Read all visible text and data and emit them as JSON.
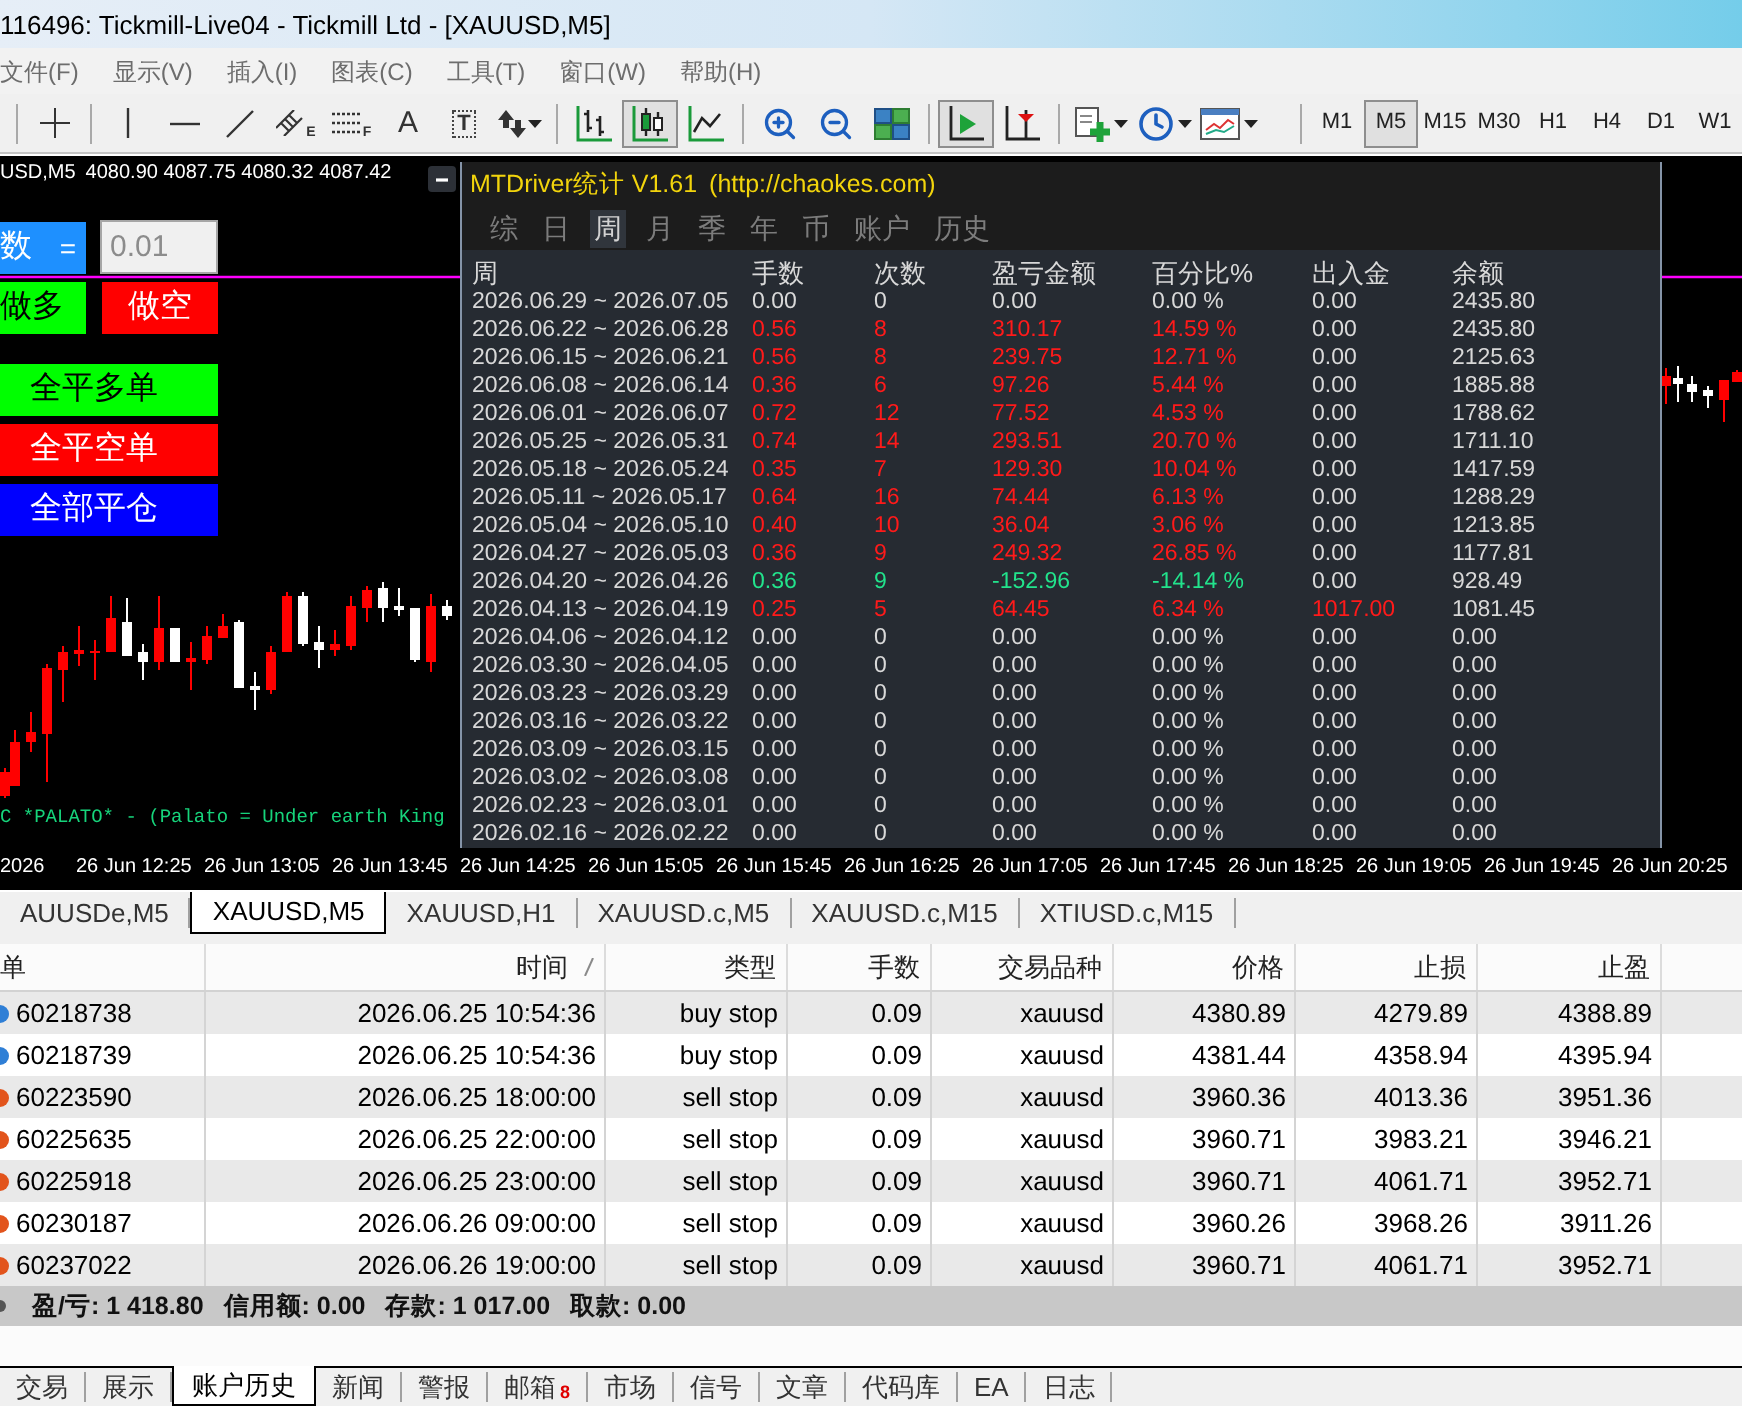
{
  "window": {
    "title": "116496: Tickmill-Live04 - Tickmill Ltd - [XAUUSD,M5]"
  },
  "menu": [
    "文件(F)",
    "显示(V)",
    "插入(I)",
    "图表(C)",
    "工具(T)",
    "窗口(W)",
    "帮助(H)"
  ],
  "toolbar": {
    "drawing_tools": [
      {
        "kind": "crosshair"
      },
      {
        "kind": "vline"
      },
      {
        "kind": "hline"
      },
      {
        "kind": "trendline"
      },
      {
        "kind": "channel",
        "mark": "E"
      },
      {
        "kind": "fibo",
        "mark": "F"
      },
      {
        "kind": "text",
        "mark": "A"
      },
      {
        "kind": "label",
        "mark": "T"
      },
      {
        "kind": "arrows"
      }
    ],
    "chart_types": [
      {
        "kind": "bars",
        "selected": false
      },
      {
        "kind": "candles",
        "selected": true
      },
      {
        "kind": "line",
        "selected": false
      }
    ],
    "auto_scroll": {
      "on": true
    },
    "chart_shift": {
      "on": false
    },
    "timeframes": [
      {
        "label": "M1",
        "selected": false
      },
      {
        "label": "M5",
        "selected": true
      },
      {
        "label": "M15",
        "selected": false
      },
      {
        "label": "M30",
        "selected": false
      },
      {
        "label": "H1",
        "selected": false
      },
      {
        "label": "H4",
        "selected": false
      },
      {
        "label": "D1",
        "selected": false
      },
      {
        "label": "W1",
        "selected": false
      }
    ]
  },
  "chart": {
    "symbol": "USD,M5",
    "ohlc": "4080.90 4087.75 4080.32 4087.42",
    "lot_label": "数",
    "lot_sign": "=",
    "lot_input": {
      "value": "0.01"
    },
    "order_buttons": [
      {
        "label": "做多",
        "kind": "long"
      },
      {
        "label": "做空",
        "kind": "short"
      }
    ],
    "close_buttons": [
      {
        "label": "全平多单",
        "kind": "long"
      },
      {
        "label": "全平空单",
        "kind": "short"
      },
      {
        "label": "全部平仓",
        "kind": "all"
      }
    ],
    "comment": "C *PALATO* - (Palato = Under earth King",
    "time_axis": [
      "2026",
      "26 Jun 12:25",
      "26 Jun 13:05",
      "26 Jun 13:45",
      "26 Jun 14:25",
      "26 Jun 15:05",
      "26 Jun 15:45",
      "26 Jun 16:25",
      "26 Jun 17:05",
      "26 Jun 17:45",
      "26 Jun 18:25",
      "26 Jun 19:05",
      "26 Jun 19:45",
      "26 Jun 20:25"
    ]
  },
  "stats_panel": {
    "title": "MTDriver统计 V1.61",
    "url": "(http://chaokes.com)",
    "tabs": [
      {
        "label": "综",
        "selected": false
      },
      {
        "label": "日",
        "selected": false
      },
      {
        "label": "周",
        "selected": true
      },
      {
        "label": "月",
        "selected": false
      },
      {
        "label": "季",
        "selected": false
      },
      {
        "label": "年",
        "selected": false
      },
      {
        "label": "币",
        "selected": false
      },
      {
        "label": "账户",
        "selected": false
      },
      {
        "label": "历史",
        "selected": false
      }
    ],
    "columns": [
      "周",
      "手数",
      "次数",
      "盈亏金额",
      "百分比%",
      "出入金",
      "余额"
    ],
    "rows": [
      {
        "cells": [
          "2026.06.29 ~ 2026.07.05",
          "0.00",
          "0",
          "0.00",
          "0.00 %",
          "0.00",
          "2435.80"
        ],
        "kind": "flat",
        "deposit_marked": false
      },
      {
        "cells": [
          "2026.06.22 ~ 2026.06.28",
          "0.56",
          "8",
          "310.17",
          "14.59 %",
          "0.00",
          "2435.80"
        ],
        "kind": "gain",
        "deposit_marked": false
      },
      {
        "cells": [
          "2026.06.15 ~ 2026.06.21",
          "0.56",
          "8",
          "239.75",
          "12.71 %",
          "0.00",
          "2125.63"
        ],
        "kind": "gain",
        "deposit_marked": false
      },
      {
        "cells": [
          "2026.06.08 ~ 2026.06.14",
          "0.36",
          "6",
          "97.26",
          "5.44 %",
          "0.00",
          "1885.88"
        ],
        "kind": "gain",
        "deposit_marked": false
      },
      {
        "cells": [
          "2026.06.01 ~ 2026.06.07",
          "0.72",
          "12",
          "77.52",
          "4.53 %",
          "0.00",
          "1788.62"
        ],
        "kind": "gain",
        "deposit_marked": false
      },
      {
        "cells": [
          "2026.05.25 ~ 2026.05.31",
          "0.74",
          "14",
          "293.51",
          "20.70 %",
          "0.00",
          "1711.10"
        ],
        "kind": "gain",
        "deposit_marked": false
      },
      {
        "cells": [
          "2026.05.18 ~ 2026.05.24",
          "0.35",
          "7",
          "129.30",
          "10.04 %",
          "0.00",
          "1417.59"
        ],
        "kind": "gain",
        "deposit_marked": false
      },
      {
        "cells": [
          "2026.05.11 ~ 2026.05.17",
          "0.64",
          "16",
          "74.44",
          "6.13 %",
          "0.00",
          "1288.29"
        ],
        "kind": "gain",
        "deposit_marked": false
      },
      {
        "cells": [
          "2026.05.04 ~ 2026.05.10",
          "0.40",
          "10",
          "36.04",
          "3.06 %",
          "0.00",
          "1213.85"
        ],
        "kind": "gain",
        "deposit_marked": false
      },
      {
        "cells": [
          "2026.04.27 ~ 2026.05.03",
          "0.36",
          "9",
          "249.32",
          "26.85 %",
          "0.00",
          "1177.81"
        ],
        "kind": "gain",
        "deposit_marked": false
      },
      {
        "cells": [
          "2026.04.20 ~ 2026.04.26",
          "0.36",
          "9",
          "-152.96",
          "-14.14 %",
          "0.00",
          "928.49"
        ],
        "kind": "loss",
        "deposit_marked": false
      },
      {
        "cells": [
          "2026.04.13 ~ 2026.04.19",
          "0.25",
          "5",
          "64.45",
          "6.34 %",
          "1017.00",
          "1081.45"
        ],
        "kind": "gain",
        "deposit_marked": true
      },
      {
        "cells": [
          "2026.04.06 ~ 2026.04.12",
          "0.00",
          "0",
          "0.00",
          "0.00 %",
          "0.00",
          "0.00"
        ],
        "kind": "flat",
        "deposit_marked": false
      },
      {
        "cells": [
          "2026.03.30 ~ 2026.04.05",
          "0.00",
          "0",
          "0.00",
          "0.00 %",
          "0.00",
          "0.00"
        ],
        "kind": "flat",
        "deposit_marked": false
      },
      {
        "cells": [
          "2026.03.23 ~ 2026.03.29",
          "0.00",
          "0",
          "0.00",
          "0.00 %",
          "0.00",
          "0.00"
        ],
        "kind": "flat",
        "deposit_marked": false
      },
      {
        "cells": [
          "2026.03.16 ~ 2026.03.22",
          "0.00",
          "0",
          "0.00",
          "0.00 %",
          "0.00",
          "0.00"
        ],
        "kind": "flat",
        "deposit_marked": false
      },
      {
        "cells": [
          "2026.03.09 ~ 2026.03.15",
          "0.00",
          "0",
          "0.00",
          "0.00 %",
          "0.00",
          "0.00"
        ],
        "kind": "flat",
        "deposit_marked": false
      },
      {
        "cells": [
          "2026.03.02 ~ 2026.03.08",
          "0.00",
          "0",
          "0.00",
          "0.00 %",
          "0.00",
          "0.00"
        ],
        "kind": "flat",
        "deposit_marked": false
      },
      {
        "cells": [
          "2026.02.23 ~ 2026.03.01",
          "0.00",
          "0",
          "0.00",
          "0.00 %",
          "0.00",
          "0.00"
        ],
        "kind": "flat",
        "deposit_marked": false
      },
      {
        "cells": [
          "2026.02.16 ~ 2026.02.22",
          "0.00",
          "0",
          "0.00",
          "0.00 %",
          "0.00",
          "0.00"
        ],
        "kind": "flat",
        "deposit_marked": false
      }
    ]
  },
  "chart_tabs": [
    {
      "label": "AUUSDe,M5",
      "selected": false
    },
    {
      "label": "XAUUSD,M5",
      "selected": true
    },
    {
      "label": "XAUUSD,H1",
      "selected": false
    },
    {
      "label": "XAUUSD.c,M5",
      "selected": false
    },
    {
      "label": "XAUUSD.c,M15",
      "selected": false
    },
    {
      "label": "XTIUSD.c,M15",
      "selected": false
    }
  ],
  "orders": {
    "columns": [
      {
        "label": "单",
        "sorted": false
      },
      {
        "label": "时间",
        "sorted": true
      },
      {
        "label": "类型",
        "sorted": false
      },
      {
        "label": "手数",
        "sorted": false
      },
      {
        "label": "交易品种",
        "sorted": false
      },
      {
        "label": "价格",
        "sorted": false
      },
      {
        "label": "止损",
        "sorted": false
      },
      {
        "label": "止盈",
        "sorted": false
      }
    ],
    "rows": [
      {
        "cells": [
          "60218738",
          "2026.06.25 10:54:36",
          "buy stop",
          "0.09",
          "xauusd",
          "4380.89",
          "4279.89",
          "4388.89"
        ],
        "kind": "buy"
      },
      {
        "cells": [
          "60218739",
          "2026.06.25 10:54:36",
          "buy stop",
          "0.09",
          "xauusd",
          "4381.44",
          "4358.94",
          "4395.94"
        ],
        "kind": "buy"
      },
      {
        "cells": [
          "60223590",
          "2026.06.25 18:00:00",
          "sell stop",
          "0.09",
          "xauusd",
          "3960.36",
          "4013.36",
          "3951.36"
        ],
        "kind": "sell"
      },
      {
        "cells": [
          "60225635",
          "2026.06.25 22:00:00",
          "sell stop",
          "0.09",
          "xauusd",
          "3960.71",
          "3983.21",
          "3946.21"
        ],
        "kind": "sell"
      },
      {
        "cells": [
          "60225918",
          "2026.06.25 23:00:00",
          "sell stop",
          "0.09",
          "xauusd",
          "3960.71",
          "4061.71",
          "3952.71"
        ],
        "kind": "sell"
      },
      {
        "cells": [
          "60230187",
          "2026.06.26 09:00:00",
          "sell stop",
          "0.09",
          "xauusd",
          "3960.26",
          "3968.26",
          "3911.26"
        ],
        "kind": "sell"
      },
      {
        "cells": [
          "60237022",
          "2026.06.26 19:00:00",
          "sell stop",
          "0.09",
          "xauusd",
          "3960.71",
          "4061.71",
          "3952.71"
        ],
        "kind": "sell"
      }
    ]
  },
  "summary": [
    "盈/亏: 1 418.80",
    "信用额: 0.00",
    "存款: 1 017.00",
    "取款: 0.00"
  ],
  "bottom_tabs": [
    {
      "label": "交易",
      "selected": false
    },
    {
      "label": "展示",
      "selected": false
    },
    {
      "label": "账户历史",
      "selected": true
    },
    {
      "label": "新闻",
      "selected": false
    },
    {
      "label": "警报",
      "selected": false
    },
    {
      "label": "邮箱",
      "selected": false,
      "badge": "8"
    },
    {
      "label": "市场",
      "selected": false
    },
    {
      "label": "信号",
      "selected": false
    },
    {
      "label": "文章",
      "selected": false
    },
    {
      "label": "代码库",
      "selected": false
    },
    {
      "label": "EA",
      "selected": false
    },
    {
      "label": "日志",
      "selected": false
    }
  ]
}
